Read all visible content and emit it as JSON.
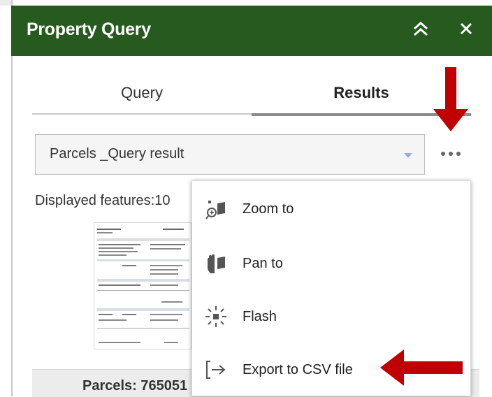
{
  "header": {
    "title": "Property Query"
  },
  "tabs": [
    {
      "label": "Query",
      "active": false
    },
    {
      "label": "Results",
      "active": true
    }
  ],
  "result_select": {
    "value": "Parcels _Query result"
  },
  "displayed_features": "Displayed features:10",
  "footer": {
    "label": "Parcels: 765051"
  },
  "menu": {
    "items": [
      {
        "label": "Zoom to",
        "icon": "zoom-to-icon"
      },
      {
        "label": "Pan to",
        "icon": "pan-to-icon"
      },
      {
        "label": "Flash",
        "icon": "flash-icon"
      },
      {
        "label": "Export to CSV file",
        "icon": "export-icon"
      }
    ]
  },
  "colors": {
    "header_bg": "#265a1f",
    "annotation_arrow": "#c00000",
    "icon_gray": "#555555"
  }
}
